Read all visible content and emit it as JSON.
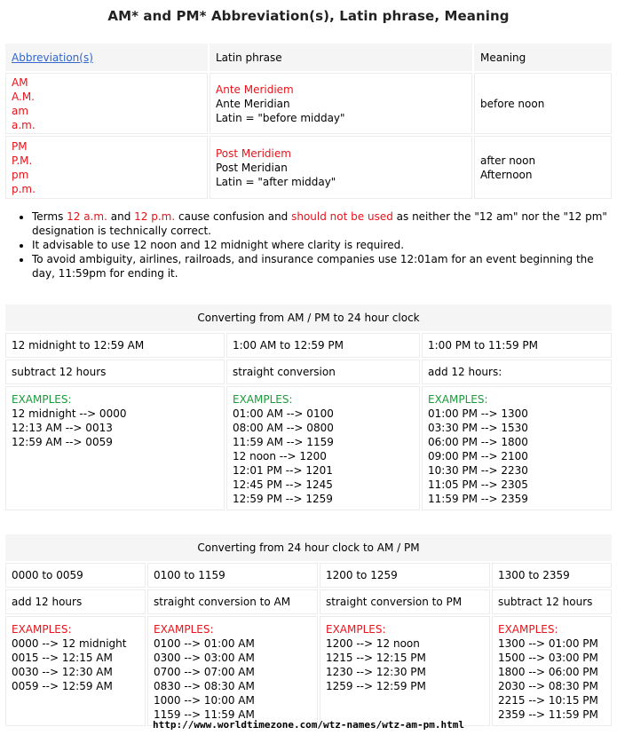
{
  "title": "AM* and PM* Abbreviation(s), Latin phrase, Meaning",
  "abbr_table": {
    "headers": {
      "abbreviations": "Abbreviation(s)",
      "latin": "Latin phrase",
      "meaning": "Meaning"
    },
    "am": {
      "abbr": [
        "AM",
        "A.M.",
        "am",
        "a.m."
      ],
      "latin_red": "Ante Meridiem",
      "latin_lines": [
        "Ante Meridian",
        "Latin = \"before midday\""
      ],
      "meaning": [
        "before noon"
      ]
    },
    "pm": {
      "abbr": [
        "PM",
        "P.M.",
        "pm",
        "p.m."
      ],
      "latin_red": "Post Meridiem",
      "latin_lines": [
        "Post Meridian",
        "Latin = \"after midday\""
      ],
      "meaning": [
        "after noon",
        "Afternoon"
      ]
    }
  },
  "notes": {
    "n1": {
      "t1": "Terms ",
      "r1": "12 a.m.",
      "t2": " and ",
      "r2": "12 p.m.",
      "t3": " cause confusion and ",
      "r3": "should not be used",
      "t4": " as neither the \"12 am\" nor the \"12 pm\" designation is technically correct."
    },
    "n2": "It advisable to use 12 noon and 12 midnight where clarity is required.",
    "n3": "To avoid ambiguity, airlines, railroads, and insurance companies use 12:01am for an event beginning the day, 11:59pm for ending it."
  },
  "to24": {
    "caption": "Converting from AM / PM to 24 hour clock",
    "ranges": [
      "12 midnight to 12:59 AM",
      "1:00 AM to 12:59 PM",
      "1:00 PM to 11:59 PM"
    ],
    "rules": [
      "subtract 12 hours",
      "straight conversion",
      "add 12 hours:"
    ],
    "examples_label": "EXAMPLES:",
    "examples": [
      [
        "12 midnight --> 0000",
        "12:13 AM --> 0013",
        "12:59 AM --> 0059"
      ],
      [
        "01:00 AM --> 0100",
        "08:00 AM --> 0800",
        "11:59 AM --> 1159",
        "12 noon --> 1200",
        "12:01 PM --> 1201",
        "12:45 PM --> 1245",
        "12:59 PM --> 1259"
      ],
      [
        "01:00 PM --> 1300",
        "03:30 PM --> 1530",
        "06:00 PM --> 1800",
        "09:00 PM --> 2100",
        "10:30 PM --> 2230",
        "11:05 PM --> 2305",
        "11:59 PM --> 2359"
      ]
    ]
  },
  "from24": {
    "caption": "Converting from 24 hour clock to AM / PM",
    "ranges": [
      "0000 to 0059",
      "0100 to 1159",
      "1200 to 1259",
      "1300 to 2359"
    ],
    "rules": [
      "add 12 hours",
      "straight conversion to AM",
      "straight conversion to PM",
      "subtract 12 hours"
    ],
    "examples_label": "EXAMPLES:",
    "examples": [
      [
        "0000 --> 12 midnight",
        "0015 --> 12:15 AM",
        "0030 --> 12:30 AM",
        "0059 --> 12:59 AM"
      ],
      [
        "0100 --> 01:00 AM",
        "0300 --> 03:00 AM",
        "0700 --> 07:00 AM",
        "0830 --> 08:30 AM",
        "1000 --> 10:00 AM",
        "1159 --> 11:59 AM"
      ],
      [
        "1200 --> 12 noon",
        "1215 --> 12:15 PM",
        "1230 --> 12:30 PM",
        "1259 --> 12:59 PM"
      ],
      [
        "1300 --> 01:00 PM",
        "1500 --> 03:00 PM",
        "1800 --> 06:00 PM",
        "2030 --> 08:30 PM",
        "2215 --> 10:15 PM",
        "2359 --> 11:59 PM"
      ]
    ]
  },
  "footer": "http://www.worldtimezone.com/wtz-names/wtz-am-pm.html",
  "colors": {
    "red": "#e8131b",
    "green": "#1a9a3a",
    "link": "#3366cc",
    "header_bg": "#f5f5f5"
  }
}
